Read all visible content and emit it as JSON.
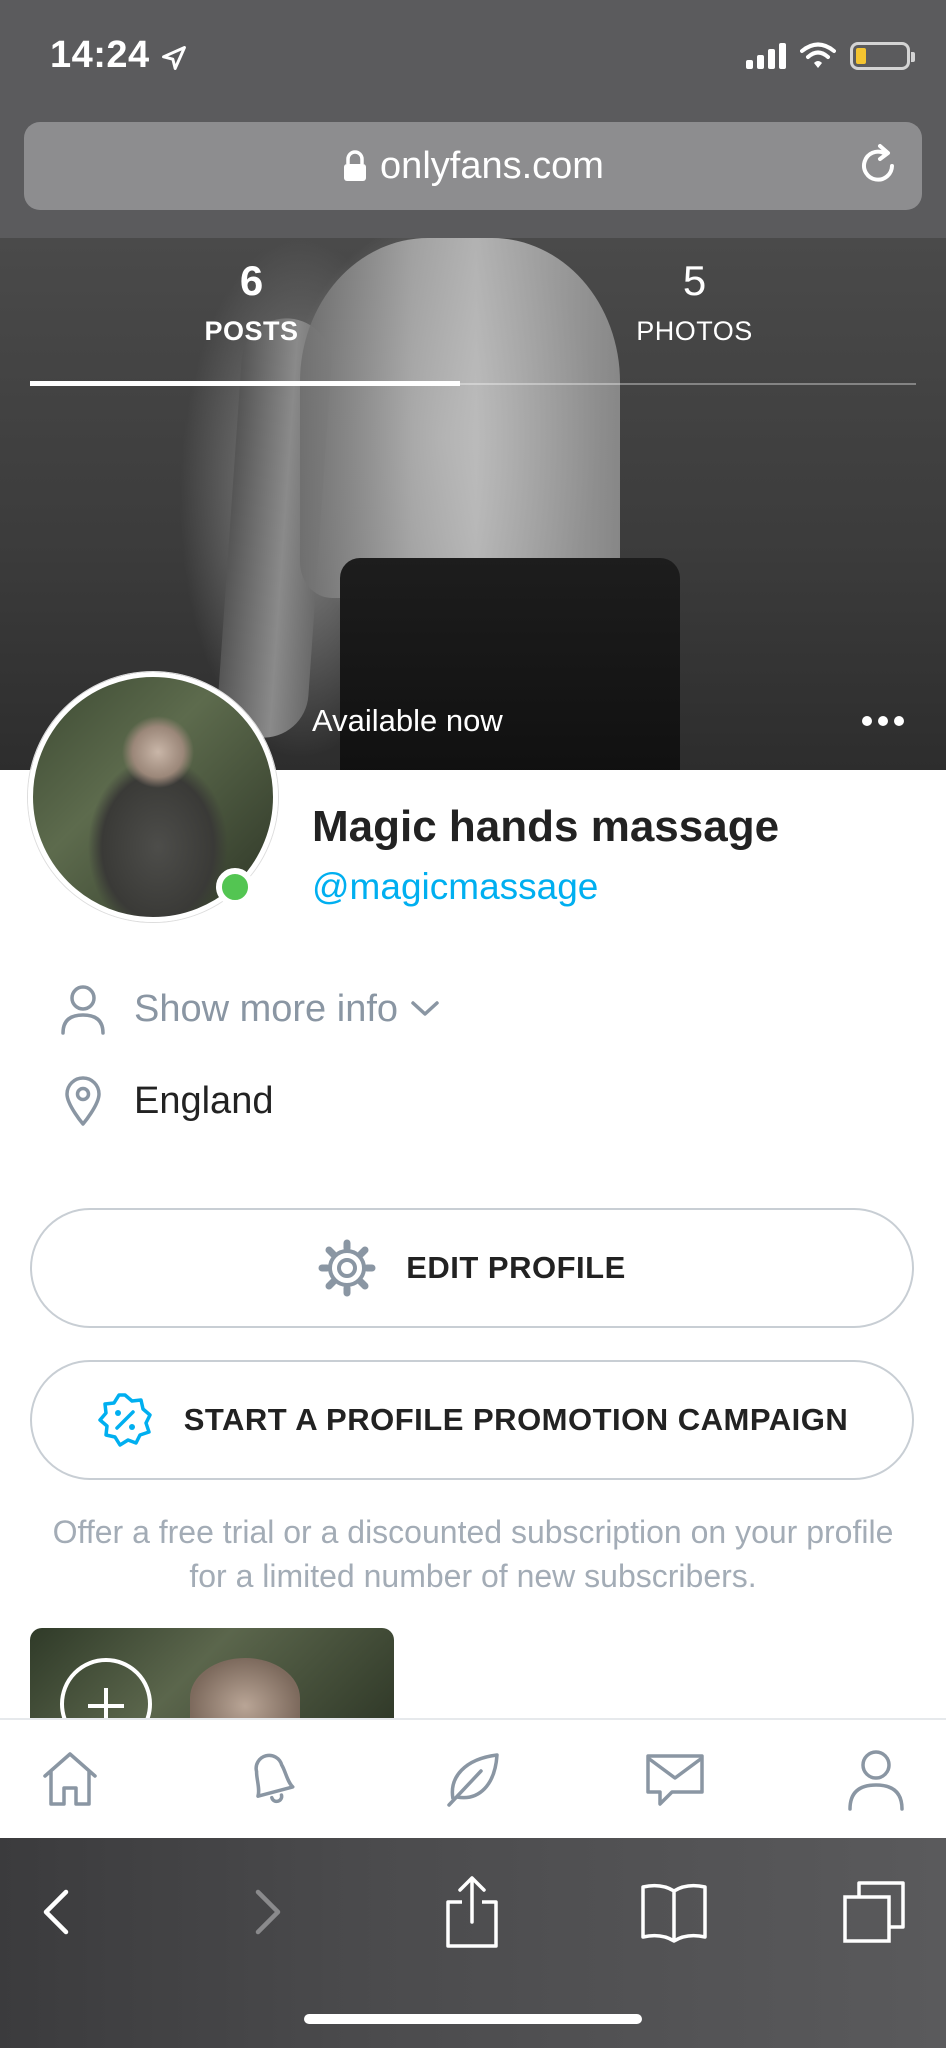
{
  "status_bar": {
    "time": "14:24"
  },
  "browser": {
    "url": "onlyfans.com"
  },
  "tabs": [
    {
      "count": "6",
      "label": "POSTS",
      "active": true
    },
    {
      "count": "5",
      "label": "PHOTOS",
      "active": false
    }
  ],
  "profile": {
    "availability": "Available now",
    "name": "Magic hands massage",
    "handle": "@magicmassage",
    "show_more": "Show more info",
    "location": "England"
  },
  "buttons": {
    "edit_profile": "EDIT PROFILE",
    "promotion": "START A PROFILE PROMOTION CAMPAIGN"
  },
  "promo_note": "Offer a free trial or a discounted subscription on your profile for a limited number of new subscribers.",
  "colors": {
    "accent": "#00aff0",
    "online": "#53c552",
    "muted_text": "#8a96a3"
  },
  "icons": {
    "nav": [
      "home-icon",
      "bell-icon",
      "leaf-icon",
      "message-icon",
      "user-icon"
    ],
    "safari": [
      "back-icon",
      "forward-icon",
      "share-icon",
      "bookmarks-icon",
      "tabs-icon"
    ]
  }
}
